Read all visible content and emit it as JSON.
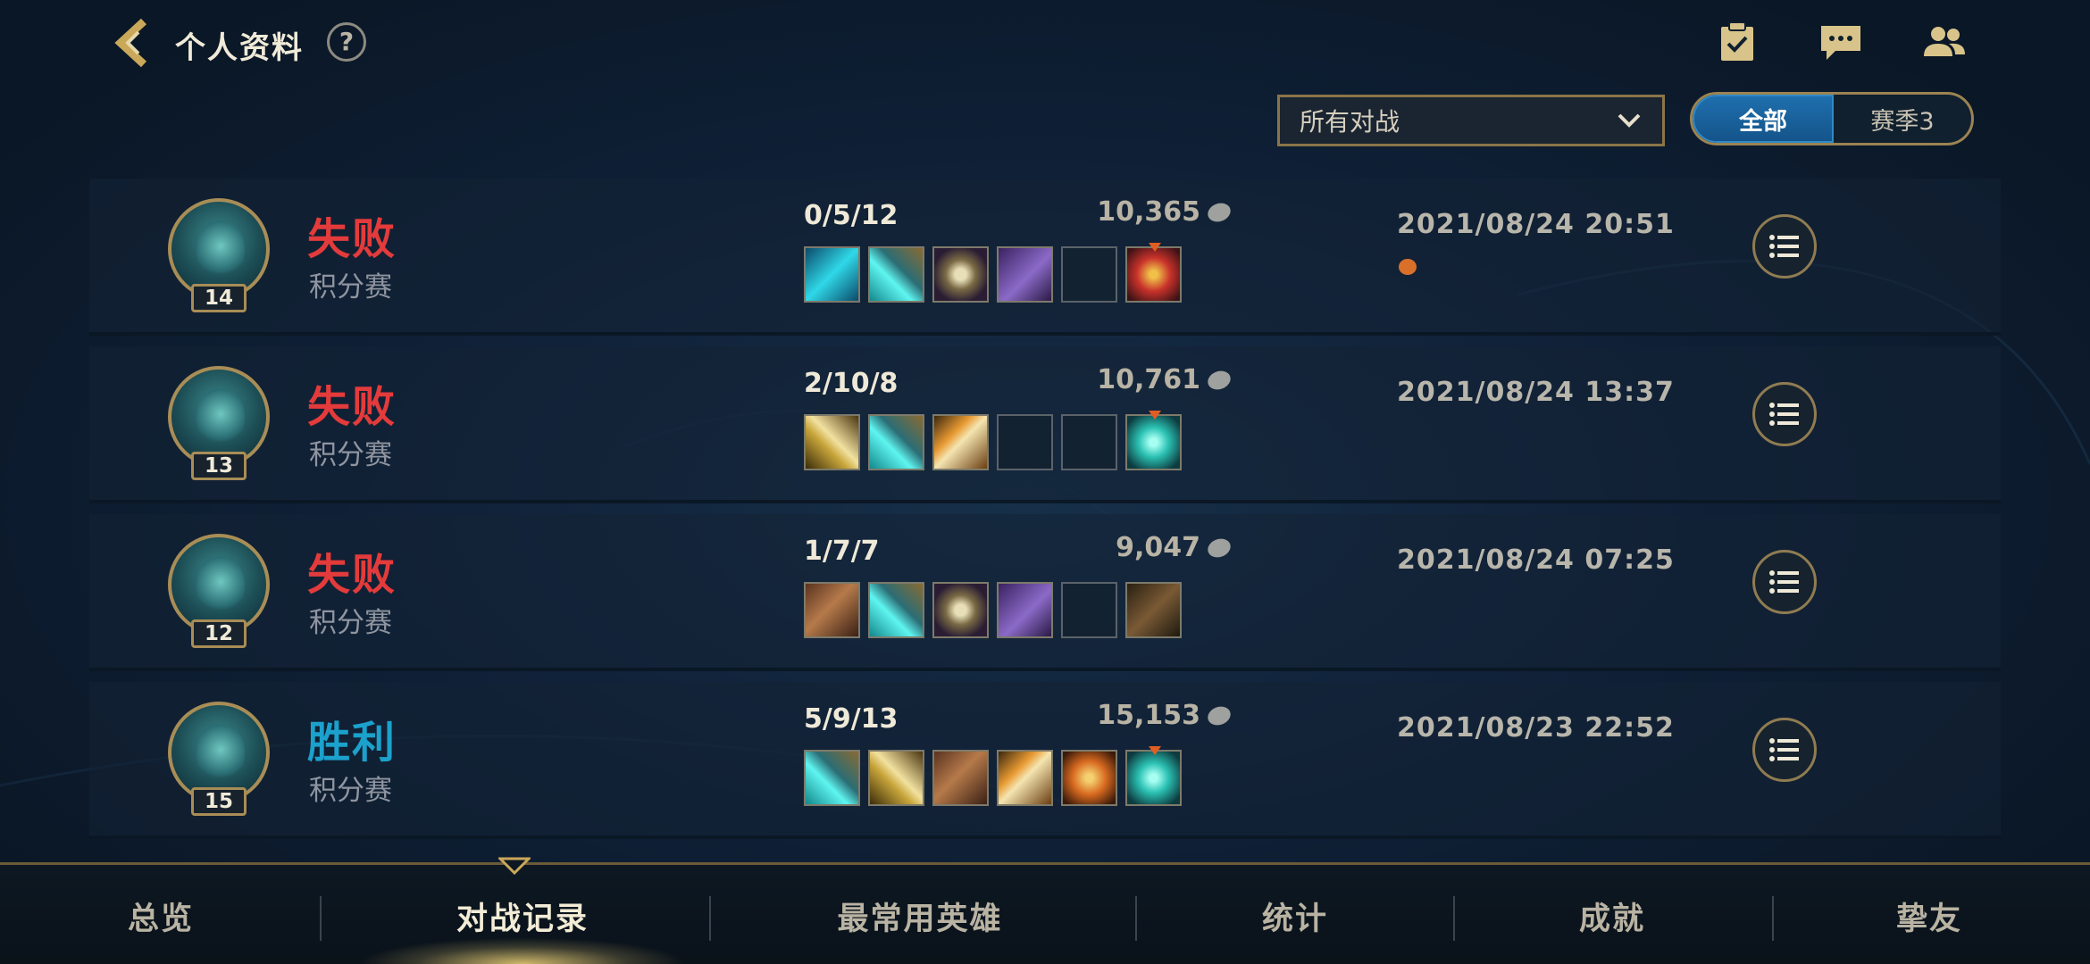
{
  "header": {
    "title": "个人资料",
    "help_label": "?"
  },
  "filters": {
    "match_type": "所有对战",
    "segments": [
      {
        "label": "全部",
        "active": true
      },
      {
        "label": "赛季3",
        "active": false
      }
    ]
  },
  "matches": [
    {
      "level": "14",
      "result": "失败",
      "mode": "积分赛",
      "kda": "0/5/12",
      "gold": "10,365",
      "items": [
        "blade-cyan",
        "sword-cyan",
        "star",
        "purple-cloak",
        "empty",
        "red-trinket"
      ],
      "datetime": "2021/08/24 20:51",
      "has_badge": true
    },
    {
      "level": "13",
      "result": "失败",
      "mode": "积分赛",
      "kda": "2/10/8",
      "gold": "10,761",
      "items": [
        "gold-blade",
        "sword-cyan",
        "lightning-blade",
        "empty",
        "empty",
        "orb-cyan-trinket"
      ],
      "datetime": "2021/08/24 13:37",
      "has_badge": false
    },
    {
      "level": "12",
      "result": "失败",
      "mode": "积分赛",
      "kda": "1/7/7",
      "gold": "9,047",
      "items": [
        "boots",
        "sword-cyan",
        "star",
        "purple-cloak",
        "empty",
        "dark-armor"
      ],
      "datetime": "2021/08/24 07:25",
      "has_badge": false
    },
    {
      "level": "15",
      "result": "胜利",
      "mode": "积分赛",
      "kda": "5/9/13",
      "gold": "15,153",
      "items": [
        "sword-cyan",
        "gold-blade",
        "boots",
        "lightning-blade",
        "orange-hammer",
        "orb-cyan-trinket"
      ],
      "datetime": "2021/08/23 22:52",
      "has_badge": false
    }
  ],
  "tabs": [
    {
      "label": "总览",
      "active": false
    },
    {
      "label": "对战记录",
      "active": true
    },
    {
      "label": "最常用英雄",
      "active": false
    },
    {
      "label": "统计",
      "active": false
    },
    {
      "label": "成就",
      "active": false
    },
    {
      "label": "挚友",
      "active": false
    }
  ],
  "icons": {
    "back": "back-chevron-icon",
    "missions": "clipboard-check-icon",
    "chat": "chat-bubble-icon",
    "friends": "friends-icon",
    "dropdown": "chevron-down-icon",
    "gold": "gold-coin-icon",
    "detail": "list-icon"
  },
  "colors": {
    "loss": "#e33b3b",
    "win": "#1ba1cc",
    "accent_gold": "#a88d56",
    "active_segment": "#1e6fae"
  }
}
